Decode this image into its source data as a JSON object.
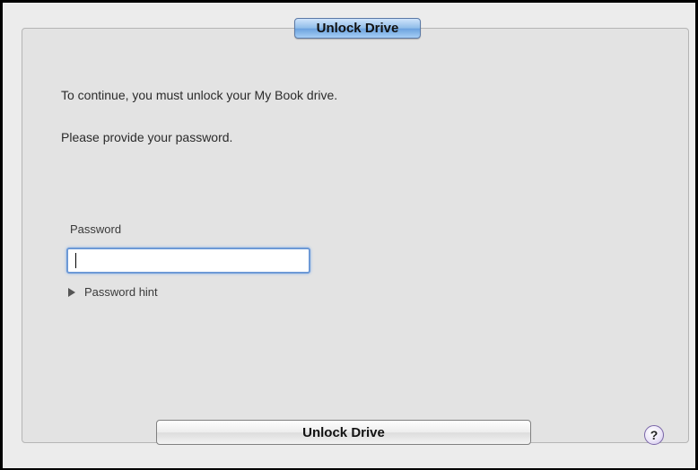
{
  "tab": {
    "label": "Unlock Drive"
  },
  "messages": {
    "line1": "To continue, you must unlock your My Book drive.",
    "line2": "Please provide your password."
  },
  "password": {
    "label": "Password",
    "value": "",
    "placeholder": ""
  },
  "hint": {
    "label": "Password hint",
    "expanded": false
  },
  "actions": {
    "unlock_label": "Unlock Drive"
  },
  "help": {
    "label": "?"
  },
  "colors": {
    "tab_accent": "#8fbce9",
    "focus_ring": "#6d99d6",
    "help_icon": "#7a66a8"
  }
}
